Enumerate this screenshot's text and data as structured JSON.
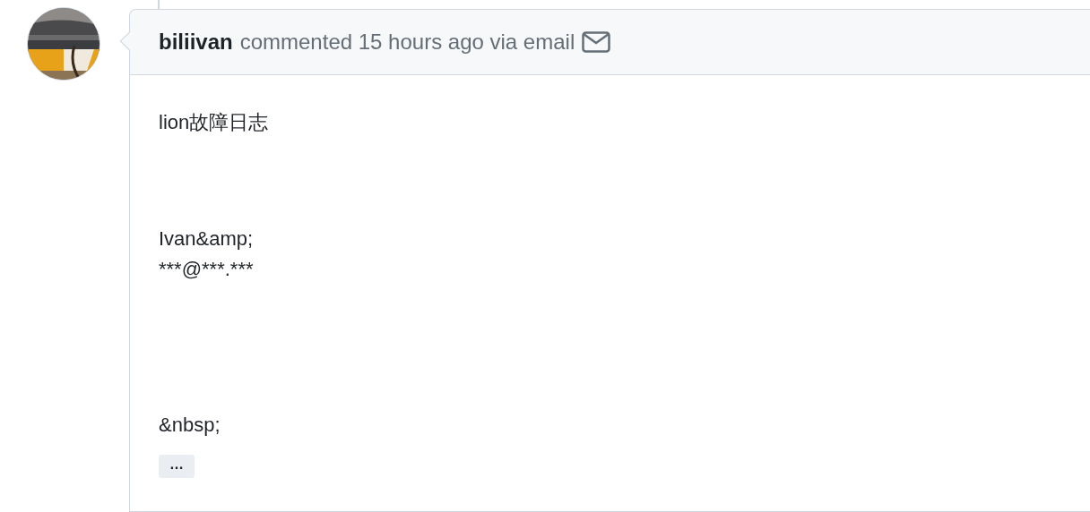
{
  "comment": {
    "author": "biliivan",
    "action": "commented 15 hours ago via email",
    "avatar": {
      "kind": "picture"
    },
    "body": [
      [
        "lion故障日志"
      ],
      [
        "Ivan&amp;",
        "***@***.***"
      ],
      [
        "&nbsp;"
      ]
    ],
    "expander": "…"
  }
}
